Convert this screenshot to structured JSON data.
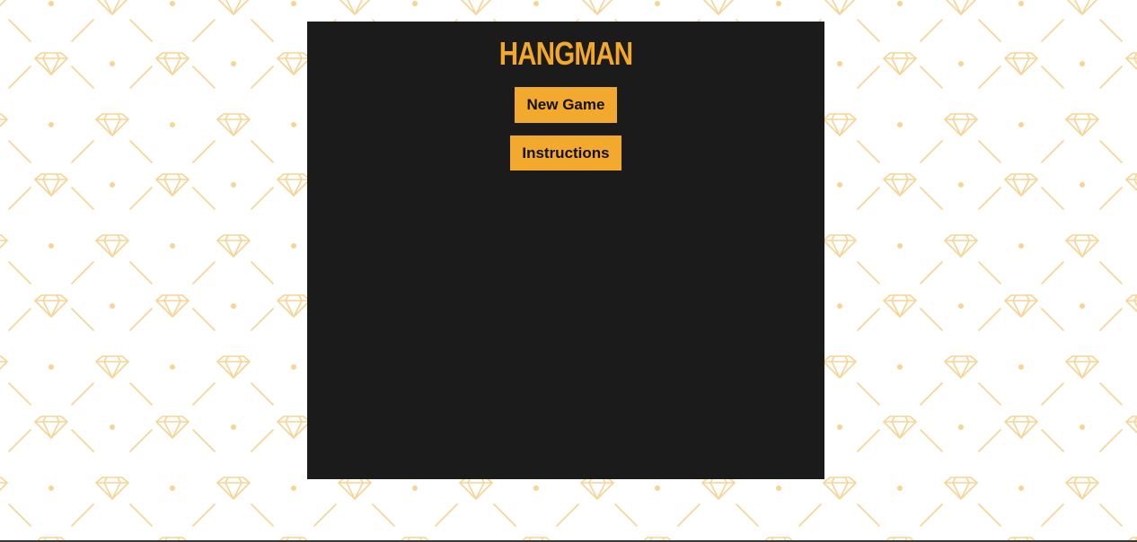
{
  "app": {
    "title": "HANGMAN"
  },
  "menu": {
    "new_game_label": "New Game",
    "instructions_label": "Instructions"
  },
  "colors": {
    "accent": "#f3a82e",
    "panel": "#1b1b1b",
    "pattern": "#f7d493",
    "background": "#ffffff"
  },
  "background": {
    "pattern_icon": "diamond-icon"
  }
}
